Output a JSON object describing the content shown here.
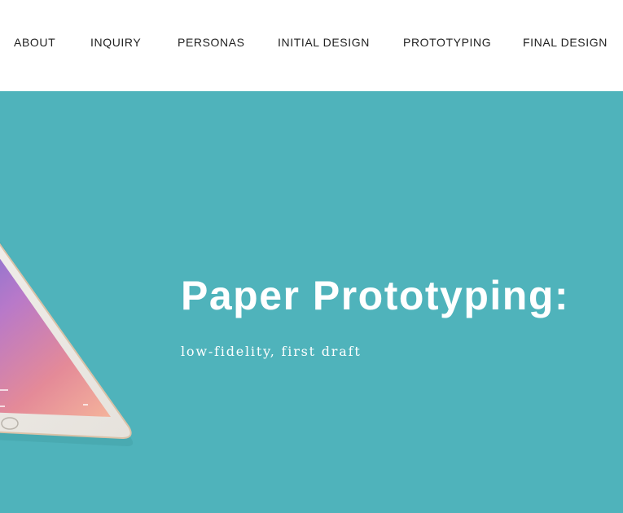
{
  "nav": {
    "items": [
      {
        "label": "ABOUT"
      },
      {
        "label": "INQUIRY"
      },
      {
        "label": "PERSONAS"
      },
      {
        "label": "INITIAL DESIGN"
      },
      {
        "label": "PROTOTYPING"
      },
      {
        "label": "FINAL DESIGN"
      }
    ]
  },
  "hero": {
    "title": "Paper Prototyping:",
    "subtitle": "low-fidelity, first draft",
    "background_color": "#4fb3bb"
  },
  "colors": {
    "text_dark": "#1f1f1f",
    "hero_text": "#ffffff"
  }
}
